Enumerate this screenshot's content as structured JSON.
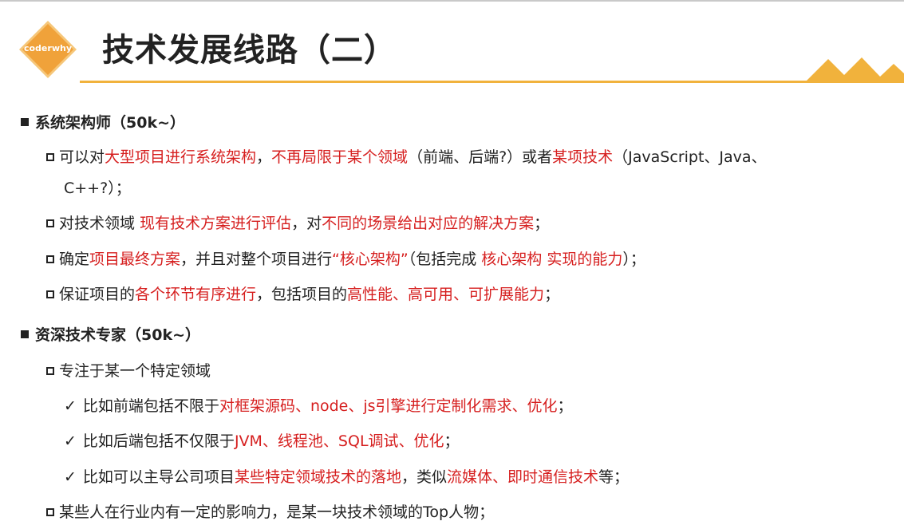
{
  "header": {
    "logo_text": "coderwhy",
    "title": "技术发展线路（二）"
  },
  "colors": {
    "accent_orange": "#f1b23c",
    "logo_orange": "#f0a23a",
    "highlight_red": "#d61f1f"
  },
  "sections": [
    {
      "heading": "系统架构师（50k~）",
      "items": [
        {
          "line1": [
            {
              "t": "可以对",
              "r": false
            },
            {
              "t": "大型项目进行系统架构",
              "r": true
            },
            {
              "t": "，",
              "r": false
            },
            {
              "t": "不再局限于某个领域",
              "r": true
            },
            {
              "t": "（前端、后端?）或者",
              "r": false
            },
            {
              "t": "某项技术",
              "r": true
            },
            {
              "t": "（JavaScript、Java、",
              "r": false
            }
          ],
          "line2": "C++?）；"
        },
        {
          "line1": [
            {
              "t": "对技术领域 ",
              "r": false
            },
            {
              "t": "现有技术方案进行评估",
              "r": true
            },
            {
              "t": "，对",
              "r": false
            },
            {
              "t": "不同的场景给出对应的解决方案",
              "r": true
            },
            {
              "t": "；",
              "r": false
            }
          ]
        },
        {
          "line1": [
            {
              "t": "确定",
              "r": false
            },
            {
              "t": "项目最终方案",
              "r": true
            },
            {
              "t": "，并且对整个项目进行",
              "r": false
            },
            {
              "t": "“核心架构”",
              "r": true
            },
            {
              "t": "（包括完成 ",
              "r": false
            },
            {
              "t": "核心架构 实现的能力",
              "r": true
            },
            {
              "t": "）；",
              "r": false
            }
          ]
        },
        {
          "line1": [
            {
              "t": "保证项目的",
              "r": false
            },
            {
              "t": "各个环节有序进行",
              "r": true
            },
            {
              "t": "，包括项目的",
              "r": false
            },
            {
              "t": "高性能、高可用、可扩展能力",
              "r": true
            },
            {
              "t": "；",
              "r": false
            }
          ]
        }
      ]
    },
    {
      "heading": "资深技术专家（50k~）",
      "items": [
        {
          "line1": [
            {
              "t": "专注于某一个特定领域",
              "r": false
            }
          ],
          "sub": [
            [
              {
                "t": "比如前端包括不限于",
                "r": false
              },
              {
                "t": "对框架源码、node、js引擎进行定制化需求、优化",
                "r": true
              },
              {
                "t": "；",
                "r": false
              }
            ],
            [
              {
                "t": "比如后端包括不仅限于",
                "r": false
              },
              {
                "t": "JVM、线程池、SQL调试、优化",
                "r": true
              },
              {
                "t": "；",
                "r": false
              }
            ],
            [
              {
                "t": "比如可以主导公司项目",
                "r": false
              },
              {
                "t": "某些特定领域技术的落地",
                "r": true
              },
              {
                "t": "，类似",
                "r": false
              },
              {
                "t": "流媒体、即时通信技术",
                "r": true
              },
              {
                "t": "等；",
                "r": false
              }
            ]
          ]
        },
        {
          "line1": [
            {
              "t": "某些人在行业内有一定的影响力，是某一块技术领域的Top人物；",
              "r": false
            }
          ]
        }
      ]
    }
  ]
}
